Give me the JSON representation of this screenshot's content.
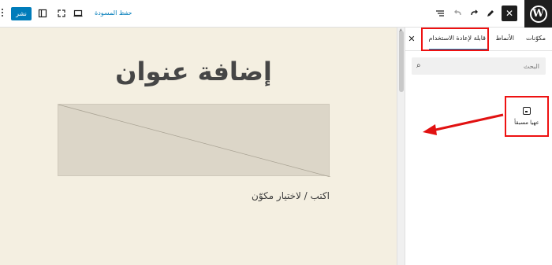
{
  "toolbar": {
    "publish_label": "نشر",
    "save_draft_label": "حفظ المسودة",
    "close_label": "✕"
  },
  "editor": {
    "heading": "إضافة عنوان",
    "paragraph_placeholder": "اكتب / لاختيار مكوّن"
  },
  "sidebar": {
    "tabs": [
      {
        "label": "مكوّنات",
        "active": false
      },
      {
        "label": "الأنماط",
        "active": false
      },
      {
        "label": "قابلة لإعادة الاستخدام",
        "active": true
      }
    ],
    "search_placeholder": "البحث",
    "pattern_item_label": "عهيا مسبقأ"
  },
  "colors": {
    "accent": "#007cba",
    "canvas_bg": "#f4efe1",
    "annotation": "#e11111",
    "dark": "#1e1e1e"
  },
  "icons": [
    "wordpress-logo-icon",
    "close-icon",
    "edit-icon",
    "redo-icon",
    "undo-icon",
    "list-view-icon",
    "desktop-preview-icon",
    "fullscreen-icon",
    "sidebar-toggle-icon",
    "more-options-icon",
    "search-icon",
    "reusable-block-icon"
  ]
}
